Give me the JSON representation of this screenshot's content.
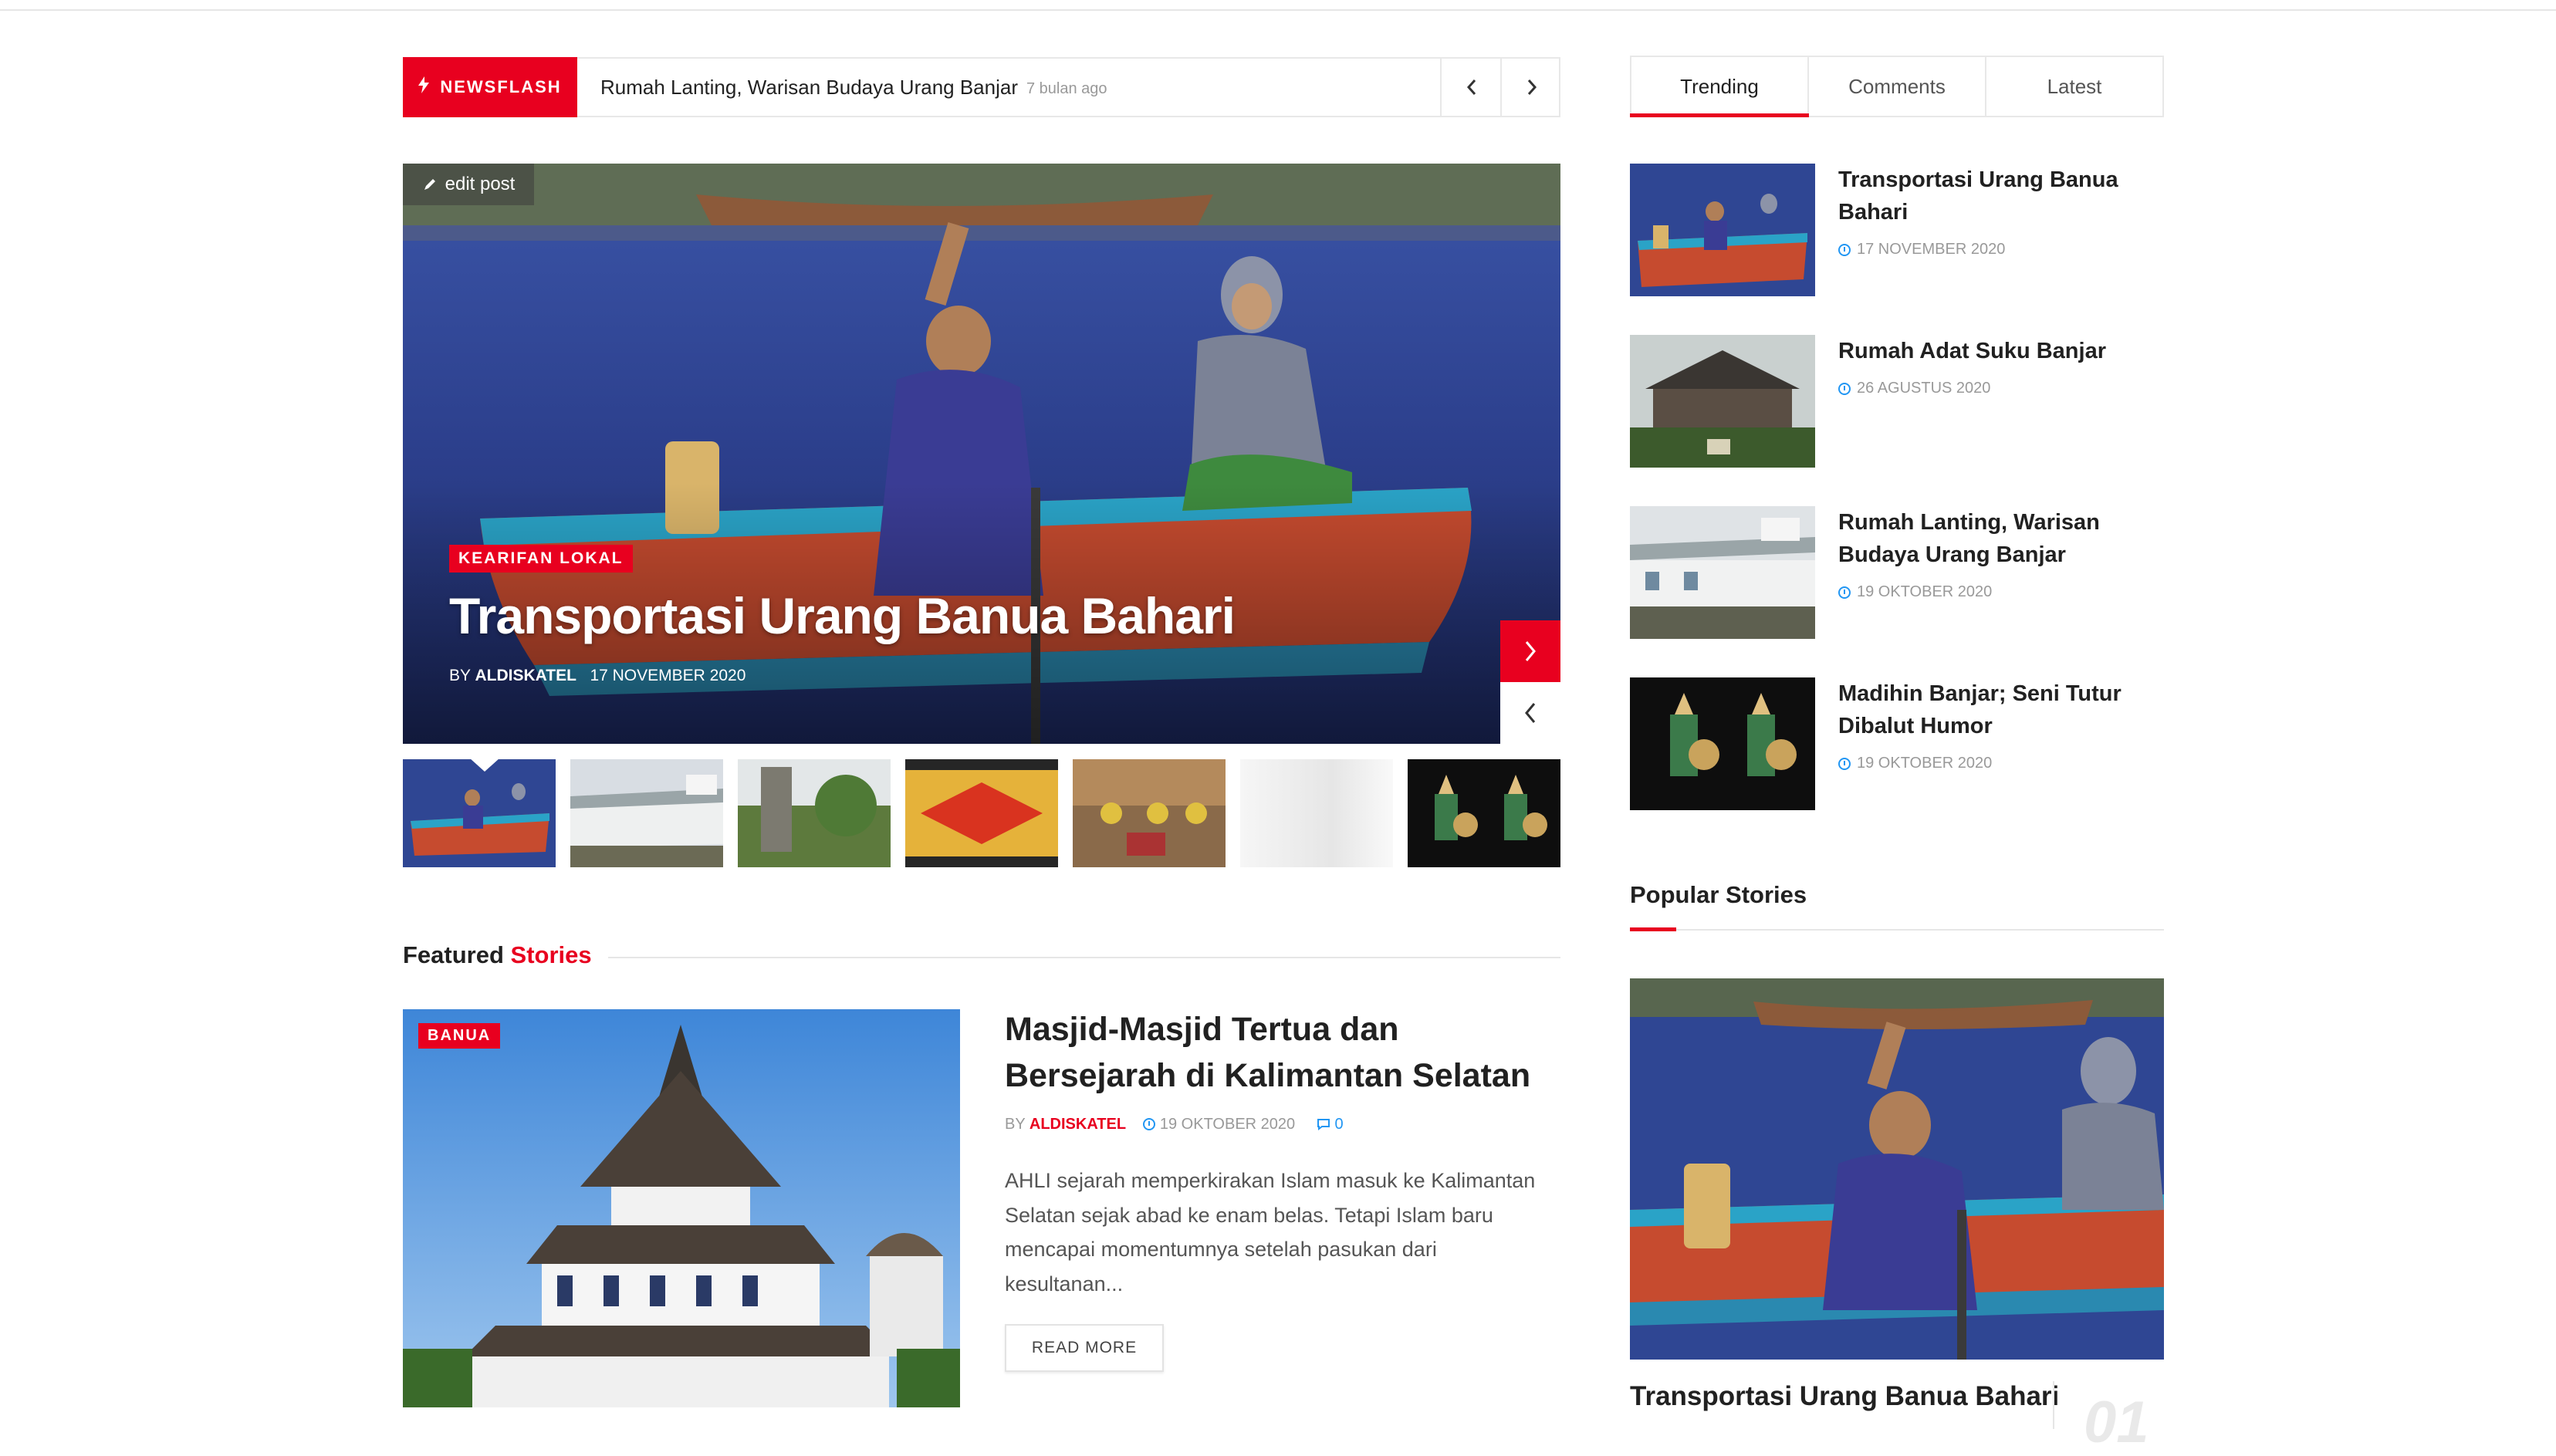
{
  "colors": {
    "accent": "#e8001f",
    "meta_blue": "#2196f3"
  },
  "newsflash": {
    "label": "NEWSFLASH",
    "title": "Rumah Lanting, Warisan Budaya Urang Banjar",
    "time": "7 bulan ago",
    "prev_icon": "chevron-left-icon",
    "next_icon": "chevron-right-icon"
  },
  "hero": {
    "edit_label": "edit post",
    "category": "KEARIFAN LOKAL",
    "title": "Transportasi Urang Banua Bahari",
    "by": "BY",
    "author": "ALDISKATEL",
    "date": "17 NOVEMBER 2020"
  },
  "featured": {
    "heading_1": "Featured",
    "heading_2": "Stories",
    "badge": "BANUA",
    "title": "Masjid-Masjid Tertua dan Bersejarah di Kalimantan Selatan",
    "by": "BY",
    "author": "ALDISKATEL",
    "date": "19 OKTOBER 2020",
    "comments": "0",
    "excerpt": "AHLI sejarah memperkirakan Islam masuk ke Kalimantan Selatan sejak abad ke enam belas. Tetapi Islam baru mencapai momentumnya setelah pasukan dari kesultanan...",
    "read_more": "READ MORE"
  },
  "tabs": [
    "Trending",
    "Comments",
    "Latest"
  ],
  "trending": [
    {
      "title": "Transportasi Urang Banua Bahari",
      "date": "17 NOVEMBER 2020"
    },
    {
      "title": "Rumah Adat Suku Banjar",
      "date": "26 AGUSTUS 2020"
    },
    {
      "title": "Rumah Lanting, Warisan Budaya Urang Banjar",
      "date": "19 OKTOBER 2020"
    },
    {
      "title": "Madihin Banjar; Seni Tutur Dibalut Humor",
      "date": "19 OKTOBER 2020"
    }
  ],
  "popular": {
    "heading": "Popular Stories",
    "title": "Transportasi Urang Banua Bahari",
    "number": "01"
  }
}
